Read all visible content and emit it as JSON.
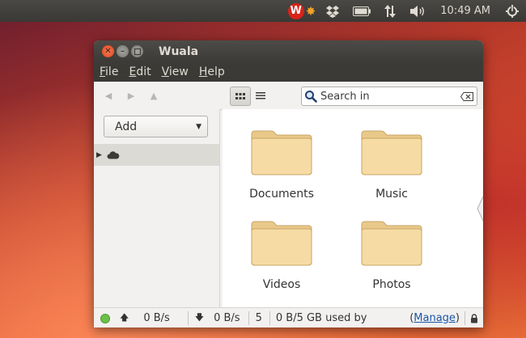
{
  "panel": {
    "wuala_letter": "W",
    "clock": "10:49 AM"
  },
  "window": {
    "title": "Wuala"
  },
  "menu": [
    {
      "label": "File",
      "mnemonic": "F",
      "rest": "ile"
    },
    {
      "label": "Edit",
      "mnemonic": "E",
      "rest": "dit"
    },
    {
      "label": "View",
      "mnemonic": "V",
      "rest": "iew"
    },
    {
      "label": "Help",
      "mnemonic": "H",
      "rest": "elp"
    }
  ],
  "search": {
    "label": "Search in"
  },
  "sidebar": {
    "add_label": "Add"
  },
  "folders": [
    {
      "name": "Documents"
    },
    {
      "name": "Music"
    },
    {
      "name": "Videos"
    },
    {
      "name": "Photos"
    }
  ],
  "status": {
    "upload_rate": "0 B/s",
    "download_rate": "0 B/s",
    "count": "5",
    "usage": "0 B/5 GB used by",
    "manage_open": "(",
    "manage_label": "Manage",
    "manage_close": ")",
    "connection_color": "#6cc04a"
  },
  "colors": {
    "accent": "#de4215",
    "folder": "#f5d59a"
  }
}
